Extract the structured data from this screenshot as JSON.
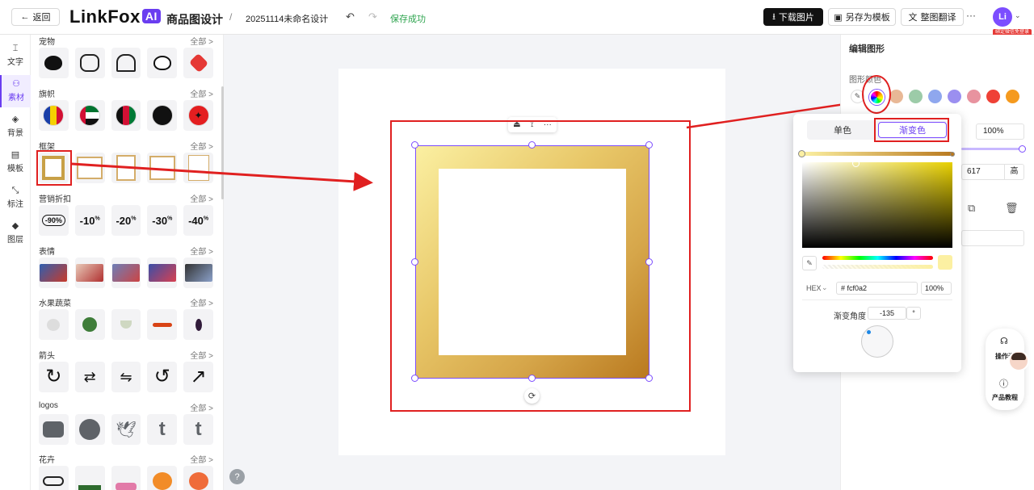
{
  "header": {
    "back_label": "返回",
    "logo_text": "LinkFox",
    "logo_ai": "AI",
    "product_title": "商品图设计",
    "separator": "/",
    "doc_name": "20251114未命名设计",
    "save_status": "保存成功",
    "download_label": "下载图片",
    "save_template_label": "另存为模板",
    "translate_label": "整图翻译",
    "more_label": "···",
    "avatar_initials": "Li",
    "login_badge": "绑定微信免登录"
  },
  "nav": {
    "items": [
      {
        "icon": "text-icon",
        "label": "文字"
      },
      {
        "icon": "assets-icon",
        "label": "素材"
      },
      {
        "icon": "background-icon",
        "label": "背景"
      },
      {
        "icon": "template-icon",
        "label": "模板"
      },
      {
        "icon": "annotation-icon",
        "label": "标注"
      },
      {
        "icon": "layers-icon",
        "label": "图层"
      }
    ]
  },
  "assets": {
    "all_label": "全部 >",
    "categories": [
      {
        "name": "宠物"
      },
      {
        "name": "旗帜"
      },
      {
        "name": "框架"
      },
      {
        "name": "营销折扣",
        "discounts": [
          "-90%",
          "-10",
          "-20",
          "-30",
          "-40"
        ]
      },
      {
        "name": "表情"
      },
      {
        "name": "水果蔬菜"
      },
      {
        "name": "箭头"
      },
      {
        "name": "logos"
      },
      {
        "name": "花卉"
      }
    ]
  },
  "canvas": {
    "toolbar_more": "···"
  },
  "right_panel": {
    "title": "编辑图形",
    "shape_color_label": "图形颜色",
    "swatches": [
      "#e8b896",
      "#9ccba8",
      "#8fa7ee",
      "#9b8ff0",
      "#e8939f",
      "#ef4136",
      "#f59a1e"
    ],
    "opacity_value": "100%",
    "height_value": "617",
    "height_label": "高"
  },
  "color_popup": {
    "tab_single": "单色",
    "tab_gradient": "渐变色",
    "format_label": "HEX",
    "hex_value": "# fcf0a2",
    "opacity": "100%",
    "angle_label": "渐变角度",
    "angle_value": "-135",
    "angle_unit": "°",
    "gradient_start": "#fcf0a2",
    "gradient_end": "#b9791f"
  },
  "float_widget": {
    "support_label": "操作咨",
    "tutorial_label": "产品教程"
  }
}
